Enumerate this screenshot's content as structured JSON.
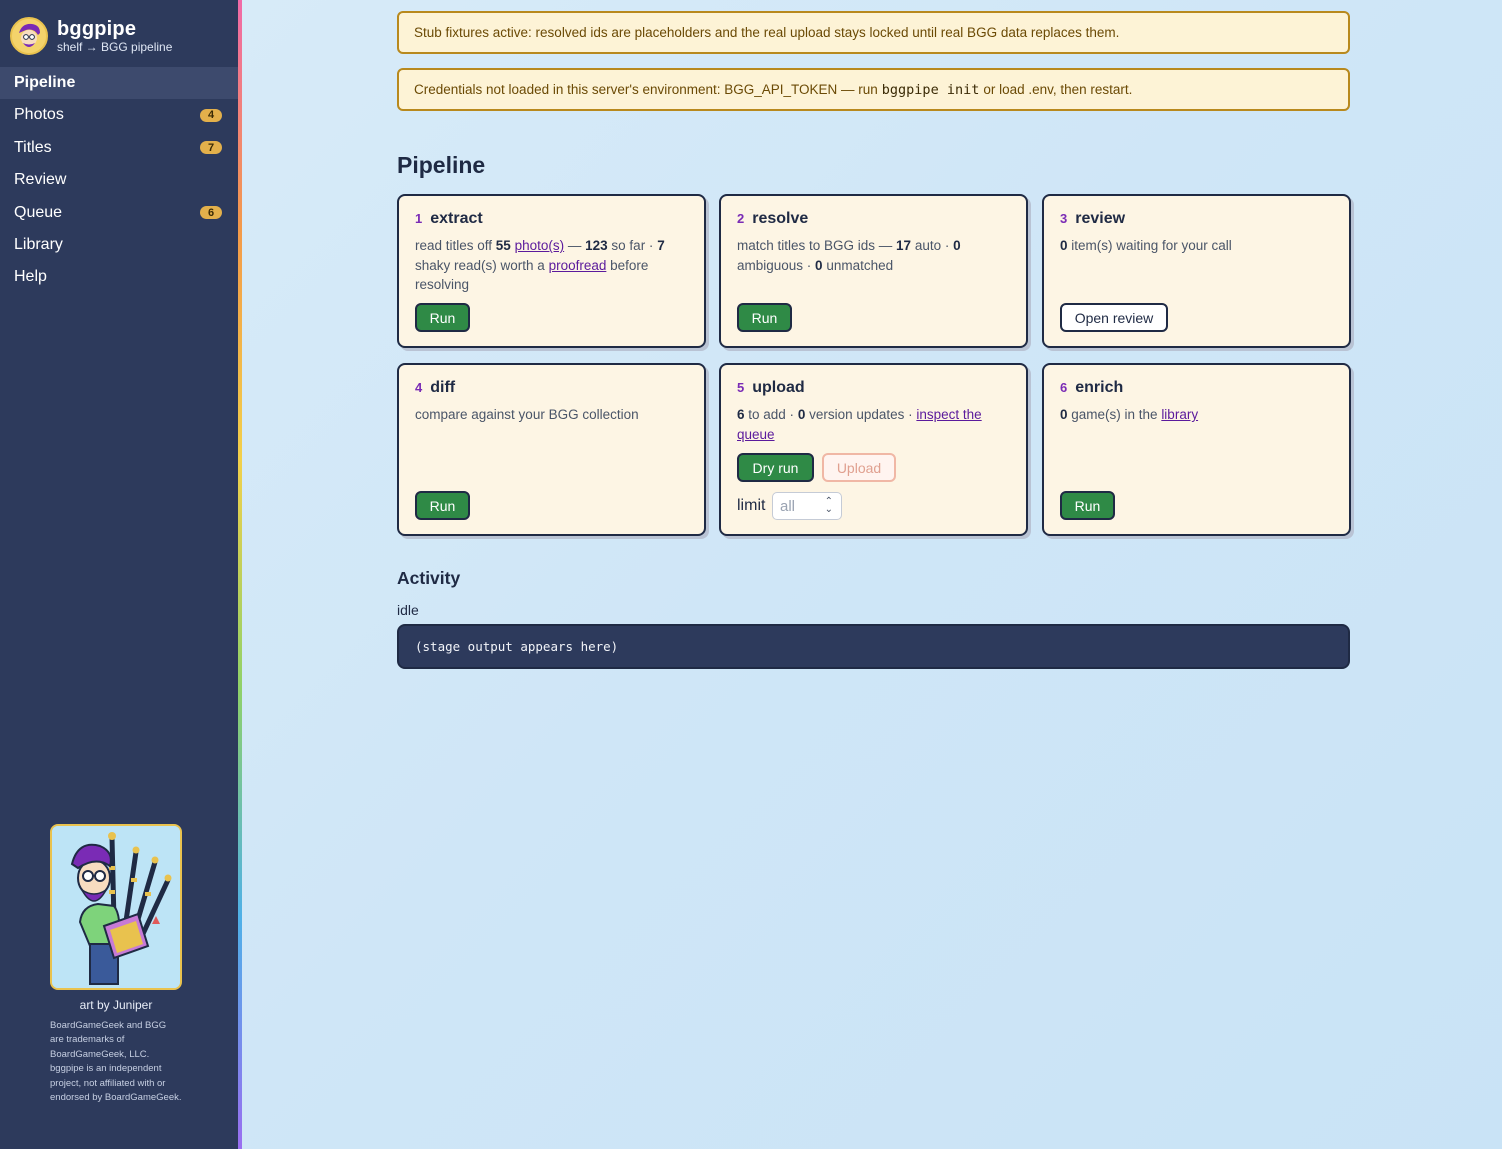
{
  "brand": {
    "title": "bggpipe",
    "subtitle": "shelf → BGG pipeline"
  },
  "nav": [
    {
      "label": "Pipeline",
      "badge": null,
      "active": true
    },
    {
      "label": "Photos",
      "badge": "4"
    },
    {
      "label": "Titles",
      "badge": "7"
    },
    {
      "label": "Review",
      "badge": null
    },
    {
      "label": "Queue",
      "badge": "6"
    },
    {
      "label": "Library",
      "badge": null
    },
    {
      "label": "Help",
      "badge": null
    }
  ],
  "art_credit": "art by Juniper",
  "disclaimer": "BoardGameGeek and BGG are trademarks of BoardGameGeek, LLC. bggpipe is an independent project, not affiliated with or endorsed by BoardGameGeek.",
  "banners": {
    "stub": "Stub fixtures active: resolved ids are placeholders and the real upload stays locked until real BGG data replaces them.",
    "cred_before": "Credentials not loaded in this server's environment: BGG_API_TOKEN — run",
    "cred_code": "bggpipe init",
    "cred_after": "or load .env, then restart."
  },
  "pipeline_title": "Pipeline",
  "cards": {
    "extract": {
      "num": "1",
      "title": "extract",
      "t1": "read titles off ",
      "n1": "55",
      "link1": "photo(s)",
      "t2": " — ",
      "n2": "123",
      "t3": " so far · ",
      "n3": "7",
      "t4": " shaky read(s) worth a ",
      "link2": "proofread",
      "t5": " before resolving",
      "run": "Run"
    },
    "resolve": {
      "num": "2",
      "title": "resolve",
      "t1": "match titles to BGG ids — ",
      "n1": "17",
      "t2": " auto · ",
      "n2": "0",
      "t3": " ambiguous · ",
      "n3": "0",
      "t4": " unmatched",
      "run": "Run"
    },
    "review": {
      "num": "3",
      "title": "review",
      "n1": "0",
      "t1": " item(s) waiting for your call",
      "open": "Open review"
    },
    "diff": {
      "num": "4",
      "title": "diff",
      "t1": "compare against your BGG collection",
      "run": "Run"
    },
    "upload": {
      "num": "5",
      "title": "upload",
      "n1": "6",
      "t1": " to add · ",
      "n2": "0",
      "t2": " version updates · ",
      "link1": "inspect the queue",
      "dry_run": "Dry run",
      "upload": "Upload",
      "limit_label": "limit",
      "limit_placeholder": "all"
    },
    "enrich": {
      "num": "6",
      "title": "enrich",
      "n1": "0",
      "t1": " game(s) in the ",
      "link1": "library",
      "run": "Run"
    }
  },
  "activity": {
    "title": "Activity",
    "status": "idle",
    "output": "(stage output appears here)"
  },
  "colors": {
    "sidebar": "#2d3a5c",
    "run_button": "#2f8a46",
    "banner_bg": "#fdf3d6",
    "banner_border": "#b8891d",
    "card_bg": "#fdf5e4",
    "accent_num": "#7a2bb5"
  }
}
